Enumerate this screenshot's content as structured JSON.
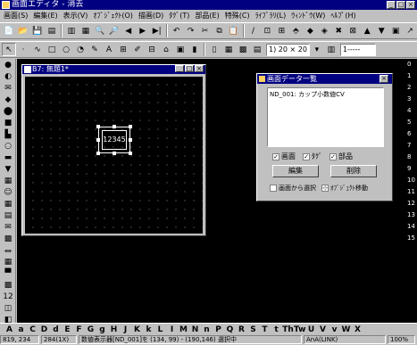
{
  "app": {
    "title": "画面エディタ - 消去"
  },
  "menu": [
    "画面(S)",
    "編集(E)",
    "表示(V)",
    "ｵﾌﾞｼﾞｪｸﾄ(O)",
    "描画(D)",
    "ﾀｸﾞ(T)",
    "部品(E)",
    "特殊(C)",
    "ﾗｲﾌﾞﾗﾘ(L)",
    "ｳｨﾝﾄﾞｳ(W)",
    "ﾍﾙﾌﾟ(H)"
  ],
  "toolbar1": {
    "icons": [
      "📄",
      "📂",
      "💾",
      "▤",
      "▥",
      "▦",
      "🔍",
      "🔎",
      "◀",
      "▶",
      "▶|",
      "↶",
      "↷",
      "✂",
      "⧉",
      "📋",
      "/",
      "⊡",
      "⊞",
      "⬘",
      "◆",
      "◈",
      "✖",
      "⊠",
      "▲",
      "▼",
      "▣",
      "↗"
    ]
  },
  "toolbar2": {
    "icons": [
      "↖",
      "·",
      "∿",
      "□",
      "○",
      "◔",
      "✎",
      "A",
      "⊞",
      "✐",
      "⊟",
      "⌂",
      "▣",
      "▮",
      "▯",
      "▦",
      "▩",
      "▤"
    ],
    "grid_size": "1) 20 × 20",
    "line_style": "1-----"
  },
  "leftbar": {
    "icons": [
      "●",
      "◐",
      "✉",
      "◆",
      "⬤",
      "■",
      "▙",
      "○",
      "▬",
      "▼",
      "▦",
      "☺",
      "▦",
      "▤",
      "✉",
      "▩",
      "⏛",
      "▦",
      "▀",
      "▩",
      "12",
      "◫",
      "◧"
    ]
  },
  "rightbar": {
    "numbers": [
      "0",
      "1",
      "2",
      "3",
      "4",
      "5",
      "6",
      "7",
      "8",
      "9",
      "10",
      "11",
      "12",
      "13",
      "14",
      "15"
    ]
  },
  "child_window": {
    "title": "B7: 無題1*",
    "numeric_display": "12345"
  },
  "dialog": {
    "title": "画面データ一覧",
    "list_item": "ND_001: カップ小数値CV",
    "check_screen": "画面",
    "check_tag": "ﾀｸﾞ",
    "check_parts": "部品",
    "edit_button": "編集",
    "delete_button": "削除",
    "select_from_screen": "画面から選択",
    "object_move": "ｵﾌﾞｼﾞｪｸﾄ移動"
  },
  "letters": [
    "A",
    "a",
    "C",
    "D",
    "d",
    "E",
    "F",
    "G",
    "g",
    "H",
    "J",
    "K",
    "k",
    "L",
    "I",
    "M",
    "N",
    "n",
    "P",
    "Q",
    "R",
    "S",
    "T",
    "t",
    "Th",
    "Tw",
    "U",
    "V",
    "v",
    "W",
    "X"
  ],
  "status": {
    "coords": "819, 234",
    "zoom": "284(1X)",
    "message": "数値表示器[ND_001]を (134, 99) - (190,146) 選択中",
    "link": "AnA(LINK)",
    "pct": "100%"
  }
}
